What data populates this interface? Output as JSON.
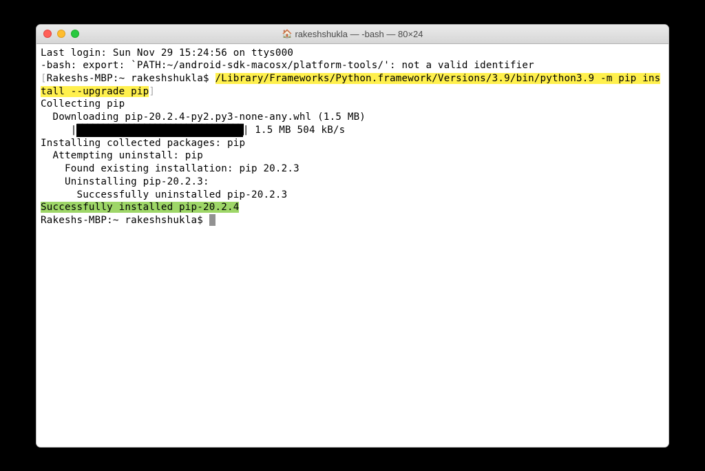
{
  "titlebar": {
    "icon": "🏠",
    "title": "rakeshshukla — -bash — 80×24"
  },
  "terminal": {
    "login_line": "Last login: Sun Nov 29 15:24:56 on ttys000",
    "error_line": "-bash: export: `PATH:~/android-sdk-macosx/platform-tools/': not a valid identifier",
    "prompt1_host": "Rakeshs-MBP:~ rakeshshukla$ ",
    "command_hl": "/Library/Frameworks/Python.framework/Versions/3.9/bin/python3.9 -m pip install --upgrade pip",
    "collecting": "Collecting pip",
    "downloading": "  Downloading pip-20.2.4-py2.py3-none-any.whl (1.5 MB)",
    "progress_prefix": "     |",
    "progress_fill": "████████████████████████████████",
    "progress_suffix": "| 1.5 MB 504 kB/s",
    "installing": "Installing collected packages: pip",
    "attempting": "  Attempting uninstall: pip",
    "found": "    Found existing installation: pip 20.2.3",
    "uninstalling": "    Uninstalling pip-20.2.3:",
    "success_uninstall": "      Successfully uninstalled pip-20.2.3",
    "success_install": "Successfully installed pip-20.2.4",
    "prompt2_host": "Rakeshs-MBP:~ rakeshshukla$ "
  }
}
